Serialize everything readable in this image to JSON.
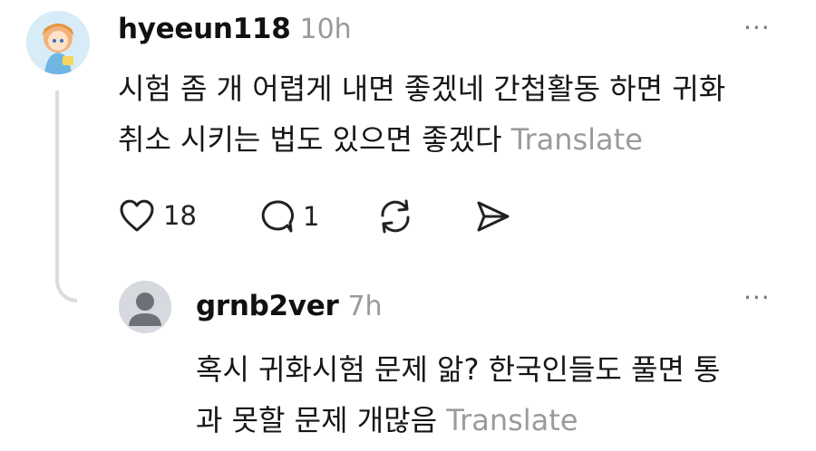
{
  "comment": {
    "username": "hyeeun118",
    "time": "10h",
    "more_label": "···",
    "text_line1": "시험 좀 개 어렵게 내면 좋겠네 간첩활동 하면 귀화",
    "text_line2": "취소 시키는 법도 있으면 좋겠다",
    "translate_label": "Translate",
    "likes": "18",
    "replies": "1",
    "icons": [
      "heart-icon",
      "comment-icon",
      "repost-icon",
      "share-icon"
    ]
  },
  "reply": {
    "username": "grnb2ver",
    "time": "7h",
    "more_label": "···",
    "text_line1": "혹시 귀화시험 문제 앎? 한국인들도 풀면 통",
    "text_line2": "과 못할 문제 개많음",
    "translate_label": "Translate"
  },
  "colors": {
    "text": "#161616",
    "muted": "#9b9b9b",
    "thread_line": "#dcdcdc"
  }
}
